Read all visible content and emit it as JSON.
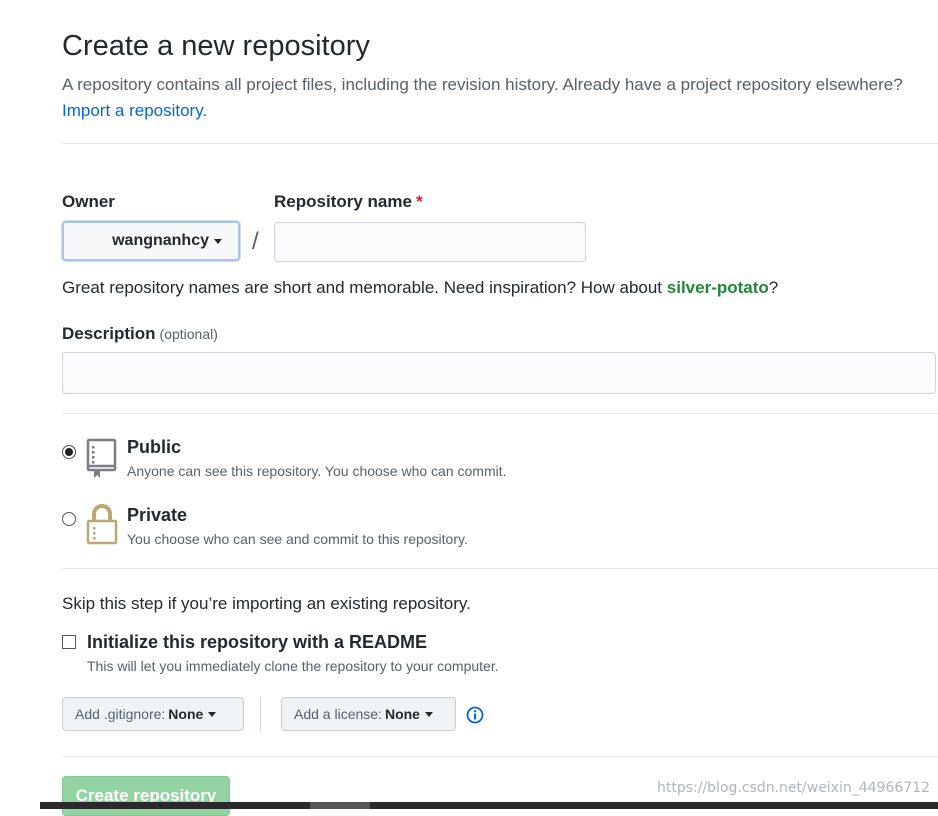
{
  "header": {
    "title": "Create a new repository",
    "subtitle": "A repository contains all project files, including the revision history. Already have a project repository elsewhere?",
    "import_link": "Import a repository."
  },
  "owner": {
    "label": "Owner",
    "value": "wangnanhcy"
  },
  "repo_name": {
    "label": "Repository name",
    "required_mark": "*",
    "value": "",
    "separator": "/"
  },
  "hint": {
    "text": "Great repository names are short and memorable. Need inspiration? How about",
    "suggestion": "silver-potato",
    "end": "?"
  },
  "description": {
    "label": "Description",
    "optional": "(optional)",
    "value": ""
  },
  "visibility": {
    "selected": "public",
    "public": {
      "title": "Public",
      "desc": "Anyone can see this repository. You choose who can commit."
    },
    "private": {
      "title": "Private",
      "desc": "You choose who can see and commit to this repository."
    }
  },
  "init": {
    "skip_text": "Skip this step if you’re importing an existing repository.",
    "readme_label": "Initialize this repository with a README",
    "readme_desc": "This will let you immediately clone the repository to your computer.",
    "readme_checked": false
  },
  "gitignore": {
    "label": "Add .gitignore:",
    "value": "None"
  },
  "license": {
    "label": "Add a license:",
    "value": "None"
  },
  "submit": {
    "label": "Create repository"
  },
  "watermark": "https://blog.csdn.net/weixin_44966712",
  "colors": {
    "link": "#0366d6",
    "suggestion": "#22863a",
    "required": "#cb2431",
    "create_button": "#94d3a2",
    "private_icon": "#b9a871"
  }
}
